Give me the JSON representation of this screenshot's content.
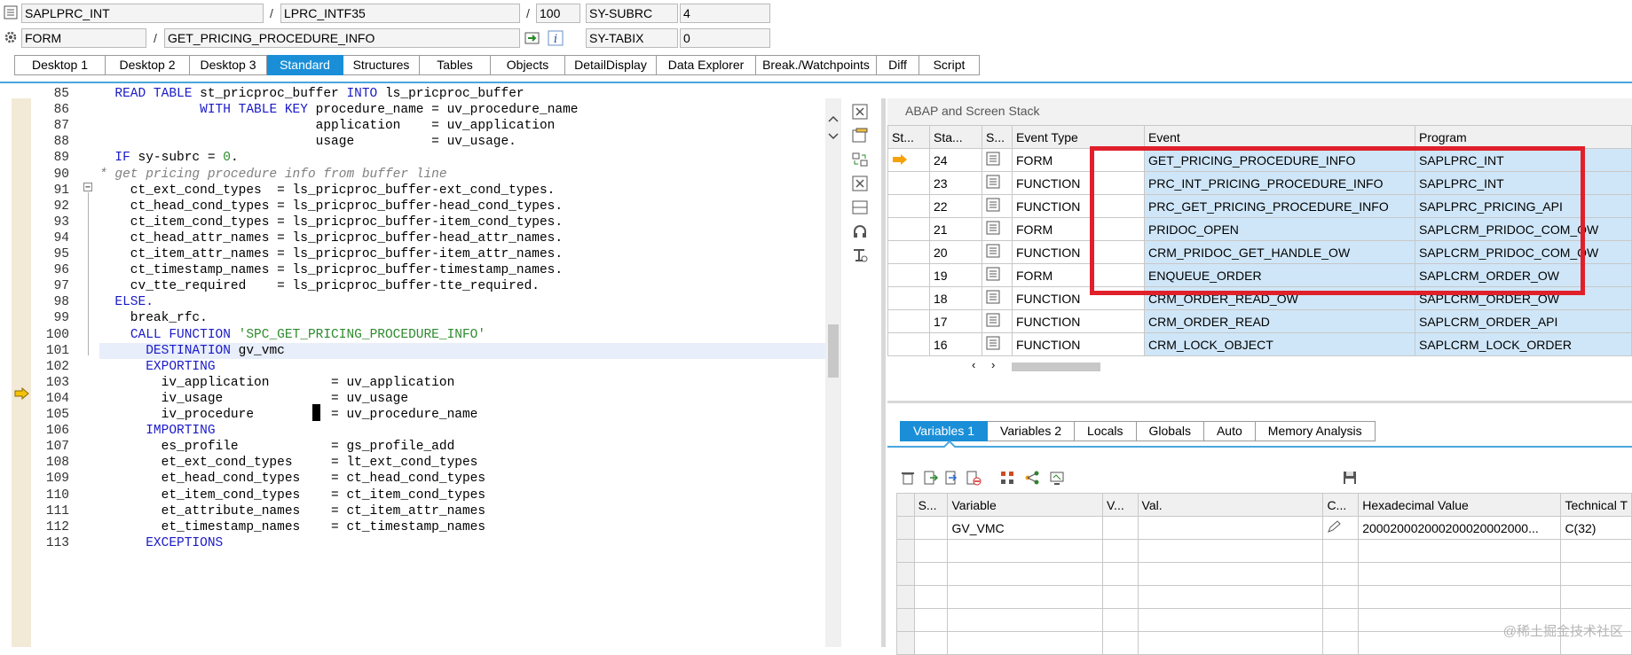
{
  "header": {
    "row1": {
      "program": "SAPLPRC_INT",
      "include": "LPRC_INTF35",
      "line": "100",
      "sysvar": "SY-SUBRC",
      "sysval": "4"
    },
    "row2": {
      "type": "FORM",
      "name": "GET_PRICING_PROCEDURE_INFO",
      "sysvar": "SY-TABIX",
      "sysval": "0"
    },
    "slash": "/"
  },
  "tabs": [
    "Desktop 1",
    "Desktop 2",
    "Desktop 3",
    "Standard",
    "Structures",
    "Tables",
    "Objects",
    "DetailDisplay",
    "Data Explorer",
    "Break./Watchpoints",
    "Diff",
    "Script"
  ],
  "active_tab": "Standard",
  "code": [
    {
      "n": "85",
      "t": "  READ TABLE st_pricproc_buffer INTO ls_pricproc_buffer"
    },
    {
      "n": "86",
      "t": "             WITH TABLE KEY procedure_name = uv_procedure_name"
    },
    {
      "n": "87",
      "t": "                            application    = uv_application"
    },
    {
      "n": "88",
      "t": "                            usage          = uv_usage."
    },
    {
      "n": "89",
      "t": "  IF sy-subrc = 0."
    },
    {
      "n": "90",
      "t": "* get pricing procedure info from buffer line"
    },
    {
      "n": "91",
      "t": "    ct_ext_cond_types  = ls_pricproc_buffer-ext_cond_types."
    },
    {
      "n": "92",
      "t": "    ct_head_cond_types = ls_pricproc_buffer-head_cond_types."
    },
    {
      "n": "93",
      "t": "    ct_item_cond_types = ls_pricproc_buffer-item_cond_types."
    },
    {
      "n": "94",
      "t": "    ct_head_attr_names = ls_pricproc_buffer-head_attr_names."
    },
    {
      "n": "95",
      "t": "    ct_item_attr_names = ls_pricproc_buffer-item_attr_names."
    },
    {
      "n": "96",
      "t": "    ct_timestamp_names = ls_pricproc_buffer-timestamp_names."
    },
    {
      "n": "97",
      "t": "    cv_tte_required    = ls_pricproc_buffer-tte_required."
    },
    {
      "n": "98",
      "t": "  ELSE."
    },
    {
      "n": "99",
      "t": "    break_rfc."
    },
    {
      "n": "100",
      "t": "    CALL FUNCTION 'SPC_GET_PRICING_PROCEDURE_INFO'"
    },
    {
      "n": "101",
      "t": "      DESTINATION gv_vmc"
    },
    {
      "n": "102",
      "t": "      EXPORTING"
    },
    {
      "n": "103",
      "t": "        iv_application        = uv_application"
    },
    {
      "n": "104",
      "t": "        iv_usage              = uv_usage"
    },
    {
      "n": "105",
      "t": "        iv_procedure          = uv_procedure_name"
    },
    {
      "n": "106",
      "t": "      IMPORTING"
    },
    {
      "n": "107",
      "t": "        es_profile            = gs_profile_add"
    },
    {
      "n": "108",
      "t": "        et_ext_cond_types     = lt_ext_cond_types"
    },
    {
      "n": "109",
      "t": "        et_head_cond_types    = ct_head_cond_types"
    },
    {
      "n": "110",
      "t": "        et_item_cond_types    = ct_item_cond_types"
    },
    {
      "n": "111",
      "t": "        et_attribute_names    = ct_item_attr_names"
    },
    {
      "n": "112",
      "t": "        et_timestamp_names    = ct_timestamp_names"
    },
    {
      "n": "113",
      "t": "      EXCEPTIONS"
    }
  ],
  "stack": {
    "title": "ABAP and Screen Stack",
    "columns": [
      "St...",
      "Sta...",
      "S...",
      "Event Type",
      "Event",
      "Program"
    ],
    "rows": [
      {
        "lvl": "24",
        "type": "FORM",
        "event": "GET_PRICING_PROCEDURE_INFO",
        "program": "SAPLPRC_INT",
        "current": true
      },
      {
        "lvl": "23",
        "type": "FUNCTION",
        "event": "PRC_INT_PRICING_PROCEDURE_INFO",
        "program": "SAPLPRC_INT"
      },
      {
        "lvl": "22",
        "type": "FUNCTION",
        "event": "PRC_GET_PRICING_PROCEDURE_INFO",
        "program": "SAPLPRC_PRICING_API"
      },
      {
        "lvl": "21",
        "type": "FORM",
        "event": "PRIDOC_OPEN",
        "program": "SAPLCRM_PRIDOC_COM_OW"
      },
      {
        "lvl": "20",
        "type": "FUNCTION",
        "event": "CRM_PRIDOC_GET_HANDLE_OW",
        "program": "SAPLCRM_PRIDOC_COM_OW"
      },
      {
        "lvl": "19",
        "type": "FORM",
        "event": "ENQUEUE_ORDER",
        "program": "SAPLCRM_ORDER_OW"
      },
      {
        "lvl": "18",
        "type": "FUNCTION",
        "event": "CRM_ORDER_READ_OW",
        "program": "SAPLCRM_ORDER_OW"
      },
      {
        "lvl": "17",
        "type": "FUNCTION",
        "event": "CRM_ORDER_READ",
        "program": "SAPLCRM_ORDER_API"
      },
      {
        "lvl": "16",
        "type": "FUNCTION",
        "event": "CRM_LOCK_OBJECT",
        "program": "SAPLCRM_LOCK_ORDER"
      }
    ]
  },
  "vartabs": [
    "Variables 1",
    "Variables 2",
    "Locals",
    "Globals",
    "Auto",
    "Memory Analysis"
  ],
  "vars": {
    "columns": [
      "S...",
      "Variable",
      "V...",
      "Val.",
      "C...",
      "Hexadecimal Value",
      "Technical T"
    ],
    "rows": [
      {
        "var": "GV_VMC",
        "hex": "200020002000200020002000...",
        "tech": "C(32)"
      }
    ]
  },
  "watermark": "@稀土掘金技术社区"
}
